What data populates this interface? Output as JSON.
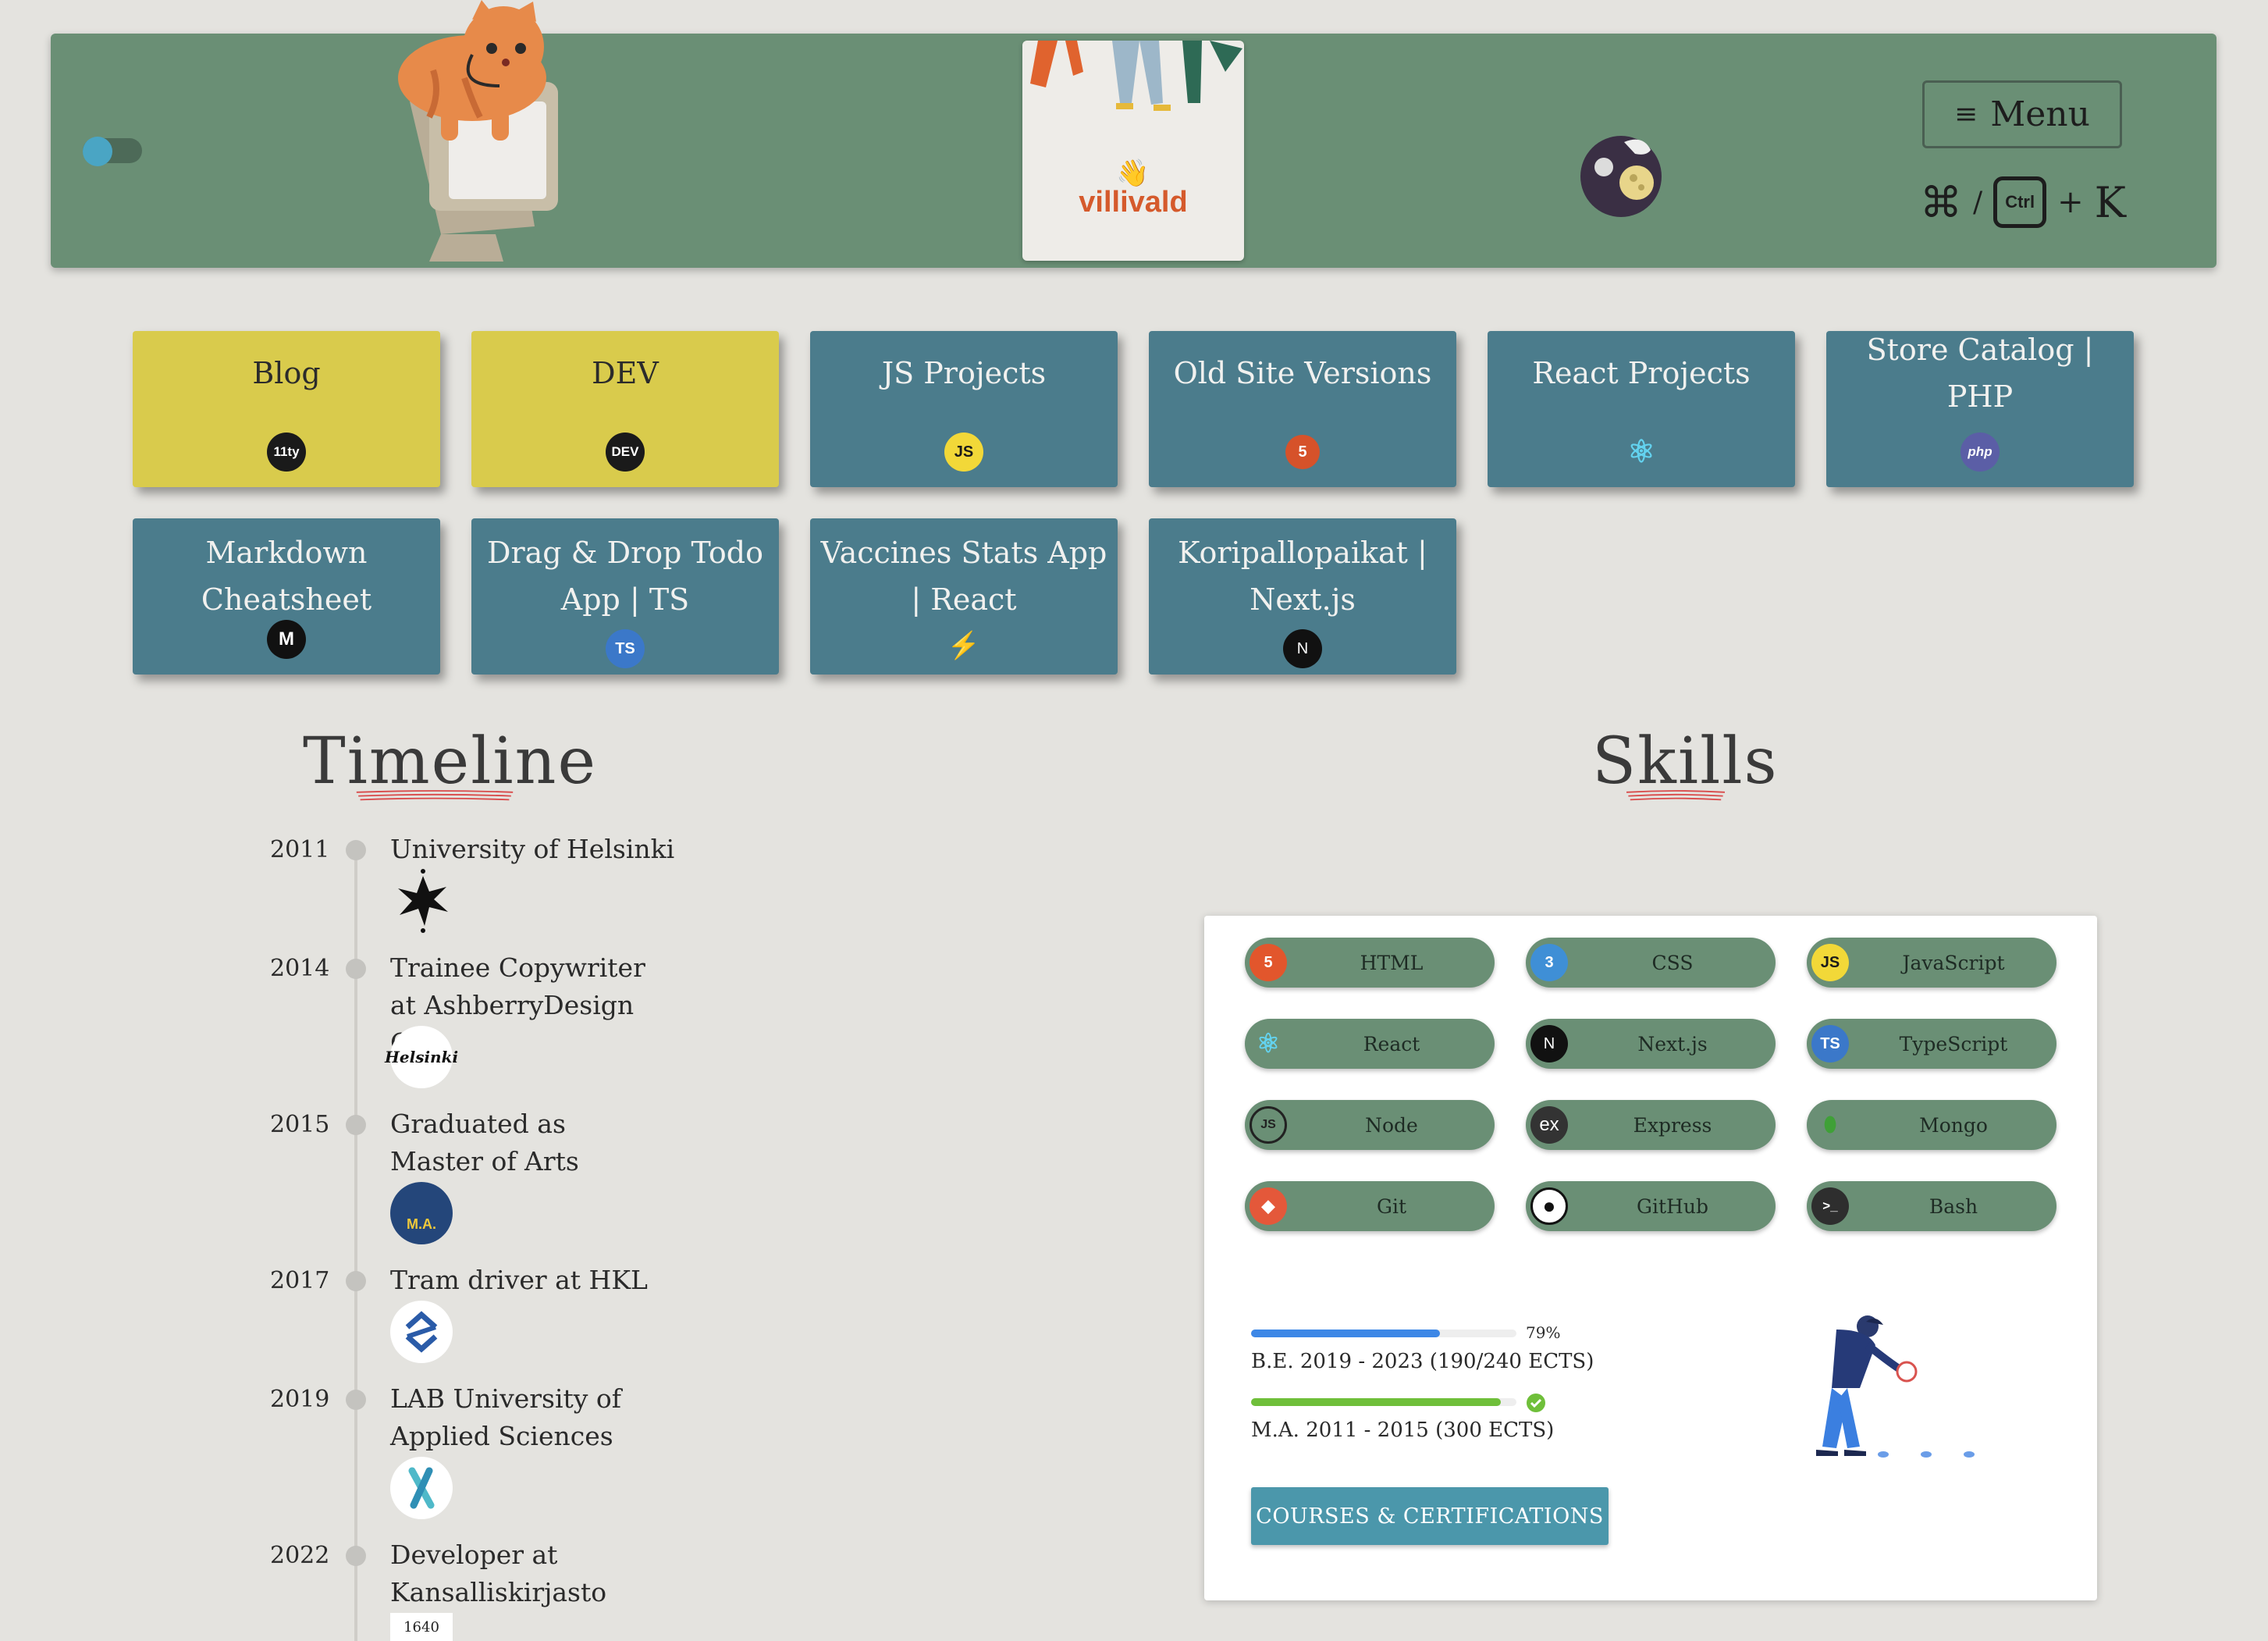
{
  "header": {
    "logo_text": "villivald",
    "logo_wave": "👋",
    "menu_label": "Menu",
    "shortcut": {
      "cmd": "⌘",
      "separator": "/",
      "ctrl": "Ctrl",
      "plus": "+",
      "key": "K"
    }
  },
  "projects": [
    {
      "title": "Blog",
      "icon": "eleventy-icon",
      "icon_text": "11ty"
    },
    {
      "title": "DEV",
      "icon": "dev-icon",
      "icon_text": "DEV"
    },
    {
      "title": "JS Projects",
      "icon": "javascript-icon",
      "icon_text": "JS"
    },
    {
      "title": "Old Site Versions",
      "icon": "html5-icon",
      "icon_text": "5"
    },
    {
      "title": "React Projects",
      "icon": "react-icon",
      "icon_text": "⚛"
    },
    {
      "title": "Store Catalog | PHP",
      "icon": "php-icon",
      "icon_text": "php"
    },
    {
      "title": "Markdown Cheatsheet",
      "icon": "markdown-icon",
      "icon_text": "M"
    },
    {
      "title": "Drag & Drop Todo App | TS",
      "icon": "typescript-icon",
      "icon_text": "TS"
    },
    {
      "title": "Vaccines Stats App | React",
      "icon": "vite-icon",
      "icon_text": "⚡"
    },
    {
      "title": "Koripallopaikat | Next.js",
      "icon": "nextjs-icon",
      "icon_text": "N"
    }
  ],
  "timeline": {
    "title": "Timeline",
    "entries": [
      {
        "year": "2011",
        "text": "University of Helsinki",
        "logo": "university-of-helsinki-logo"
      },
      {
        "year": "2014",
        "text": "Trainee Copywriter at AshberryDesign Oy",
        "logo": "helsinki-script-logo",
        "logo_text": "Helsinki"
      },
      {
        "year": "2015",
        "text": "Graduated as Master of Arts",
        "logo": "master-of-arts-logo",
        "logo_text": "M.A."
      },
      {
        "year": "2017",
        "text": "Tram driver at HKL",
        "logo": "hkl-logo"
      },
      {
        "year": "2019",
        "text": "LAB University of Applied Sciences",
        "logo": "lab-university-logo"
      },
      {
        "year": "2022",
        "text": "Developer at Kansalliskirjasto",
        "logo": "kansalliskirjasto-logo",
        "logo_text": "1640"
      }
    ]
  },
  "skills": {
    "title": "Skills",
    "items": [
      {
        "label": "HTML",
        "icon": "html5-icon",
        "icon_text": "5",
        "color": "#e2562c"
      },
      {
        "label": "CSS",
        "icon": "css3-icon",
        "icon_text": "3",
        "color": "#3f8fd6"
      },
      {
        "label": "JavaScript",
        "icon": "javascript-icon",
        "icon_text": "JS",
        "color": "#f2d838"
      },
      {
        "label": "React",
        "icon": "react-icon",
        "icon_text": "⚛",
        "color": "#6a8f75"
      },
      {
        "label": "Next.js",
        "icon": "nextjs-icon",
        "icon_text": "N",
        "color": "#111111"
      },
      {
        "label": "TypeScript",
        "icon": "typescript-icon",
        "icon_text": "TS",
        "color": "#3b78c9"
      },
      {
        "label": "Node",
        "icon": "nodejs-icon",
        "icon_text": "JS",
        "color": "#6a8f75"
      },
      {
        "label": "Express",
        "icon": "express-icon",
        "icon_text": "ex",
        "color": "#333333"
      },
      {
        "label": "Mongo",
        "icon": "mongodb-icon",
        "icon_text": "⬮",
        "color": "#6a8f75"
      },
      {
        "label": "Git",
        "icon": "git-icon",
        "icon_text": "◆",
        "color": "#e4583a"
      },
      {
        "label": "GitHub",
        "icon": "github-icon",
        "icon_text": "●",
        "color": "#ffffff"
      },
      {
        "label": "Bash",
        "icon": "terminal-icon",
        "icon_text": ">_",
        "color": "#2e2e2e"
      }
    ],
    "education": [
      {
        "label": "B.E. 2019 - 2023 (190/240 ECTS)",
        "percent_label": "79%",
        "progress": 0.79,
        "color": "#3d87e6"
      },
      {
        "label": "M.A. 2011 - 2015 (300 ECTS)",
        "progress": 1.0,
        "color": "#6fbf3a",
        "complete": true
      }
    ],
    "courses_button": "COURSES & CERTIFICATIONS"
  },
  "colors": {
    "header_green": "#6a8f75",
    "card_teal": "#4b7c8c",
    "card_yellow": "#d9cb4c",
    "background": "#e4e3df",
    "button_blue": "#4b97ab"
  }
}
